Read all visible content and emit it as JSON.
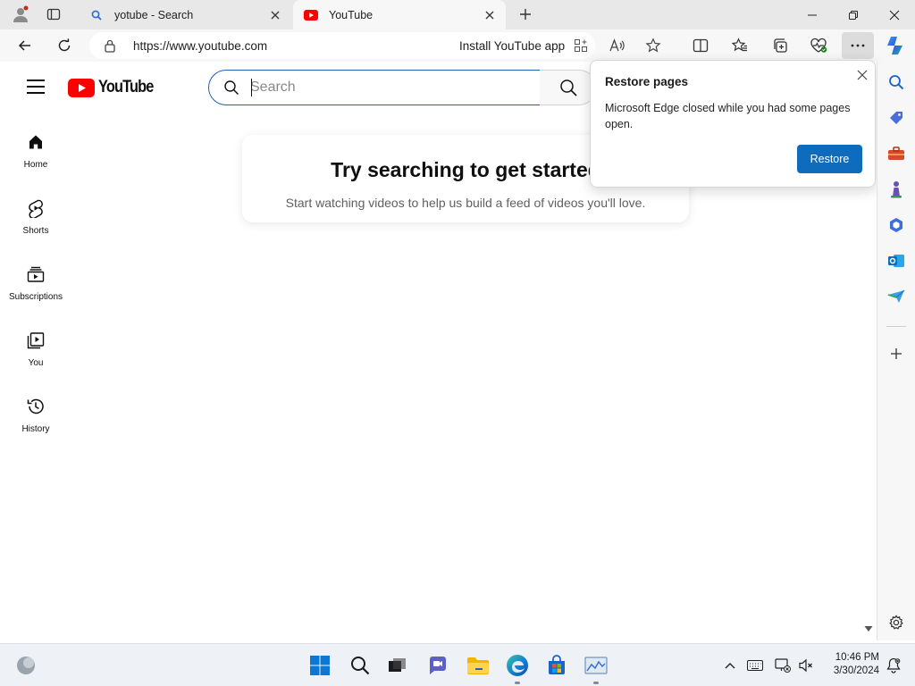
{
  "browser": {
    "tabs": [
      {
        "title": "yotube - Search",
        "favicon": "search-icon",
        "active": false
      },
      {
        "title": "YouTube",
        "favicon": "youtube-icon",
        "active": true
      }
    ],
    "url": "https://www.youtube.com",
    "install_label": "Install YouTube app"
  },
  "youtube": {
    "logo_text": "YouTube",
    "search_placeholder": "Search",
    "guide": [
      {
        "label": "Home",
        "icon": "home-icon"
      },
      {
        "label": "Shorts",
        "icon": "shorts-icon"
      },
      {
        "label": "Subscriptions",
        "icon": "subscriptions-icon"
      },
      {
        "label": "You",
        "icon": "library-icon"
      },
      {
        "label": "History",
        "icon": "history-icon"
      }
    ],
    "empty_state": {
      "title": "Try searching to get started",
      "subtitle": "Start watching videos to help us build a feed of videos you'll love."
    }
  },
  "popup": {
    "title": "Restore pages",
    "message": "Microsoft Edge closed while you had some pages open.",
    "restore_label": "Restore"
  },
  "taskbar": {
    "time": "10:46 PM",
    "date": "3/30/2024"
  },
  "colors": {
    "youtube_red": "#ff0000",
    "edge_accent": "#0f6cbd",
    "search_focus": "#1c62b9"
  }
}
